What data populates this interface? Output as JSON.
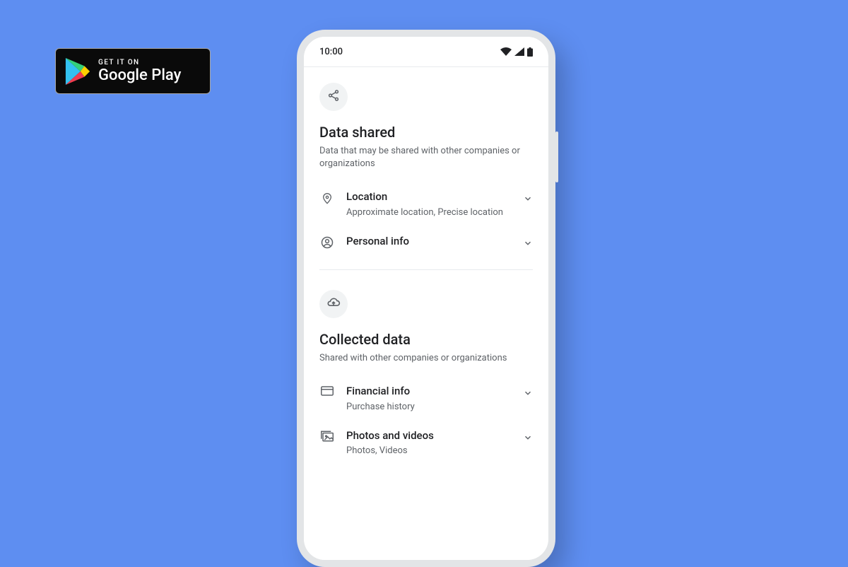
{
  "badge": {
    "line1": "GET IT ON",
    "line2": "Google Play"
  },
  "status": {
    "time": "10:00"
  },
  "sections": [
    {
      "heading": "Data shared",
      "subheading": "Data that may be shared with other companies or organizations",
      "items": [
        {
          "title": "Location",
          "desc": "Approximate location, Precise location"
        },
        {
          "title": "Personal info",
          "desc": ""
        }
      ]
    },
    {
      "heading": "Collected data",
      "subheading": "Shared with other companies or organizations",
      "items": [
        {
          "title": "Financial info",
          "desc": "Purchase history"
        },
        {
          "title": "Photos and videos",
          "desc": "Photos, Videos"
        }
      ]
    }
  ]
}
